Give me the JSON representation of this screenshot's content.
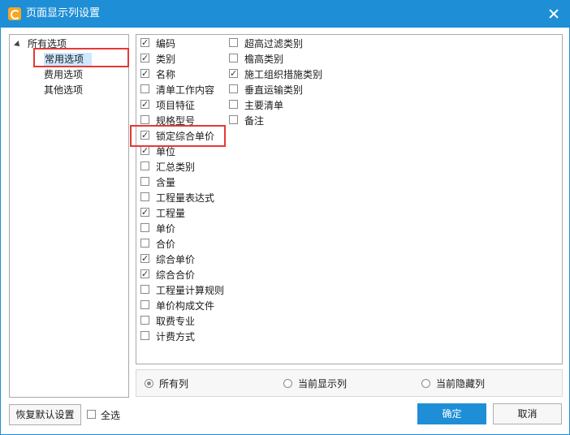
{
  "window": {
    "title": "页面显示列设置",
    "accent": "#1e8fd6"
  },
  "tree": {
    "root": "所有选项",
    "children": [
      "常用选项",
      "费用选项",
      "其他选项"
    ],
    "selected_index": 0
  },
  "columns_left": [
    {
      "label": "编码",
      "checked": true
    },
    {
      "label": "类别",
      "checked": true
    },
    {
      "label": "名称",
      "checked": true
    },
    {
      "label": "清单工作内容",
      "checked": false
    },
    {
      "label": "项目特征",
      "checked": true
    },
    {
      "label": "规格型号",
      "checked": false
    },
    {
      "label": "锁定综合单价",
      "checked": true
    },
    {
      "label": "单位",
      "checked": true
    },
    {
      "label": "汇总类别",
      "checked": false
    },
    {
      "label": "含量",
      "checked": false
    },
    {
      "label": "工程量表达式",
      "checked": false
    },
    {
      "label": "工程量",
      "checked": true
    },
    {
      "label": "单价",
      "checked": false
    },
    {
      "label": "合价",
      "checked": false
    },
    {
      "label": "综合单价",
      "checked": true
    },
    {
      "label": "综合合价",
      "checked": true
    },
    {
      "label": "工程量计算规则",
      "checked": false
    },
    {
      "label": "单价构成文件",
      "checked": false
    },
    {
      "label": "取费专业",
      "checked": false
    },
    {
      "label": "计费方式",
      "checked": false
    }
  ],
  "columns_right": [
    {
      "label": "超高过滤类别",
      "checked": false
    },
    {
      "label": "檐高类别",
      "checked": false
    },
    {
      "label": "施工组织措施类别",
      "checked": true
    },
    {
      "label": "垂直运输类别",
      "checked": false
    },
    {
      "label": "主要清单",
      "checked": false
    },
    {
      "label": "备注",
      "checked": false
    }
  ],
  "radios": [
    {
      "label": "所有列",
      "selected": true
    },
    {
      "label": "当前显示列",
      "selected": false
    },
    {
      "label": "当前隐藏列",
      "selected": false
    }
  ],
  "footer": {
    "reset_label": "恢复默认设置",
    "select_all_label": "全选",
    "select_all_checked": false,
    "ok_label": "确定",
    "cancel_label": "取消"
  }
}
